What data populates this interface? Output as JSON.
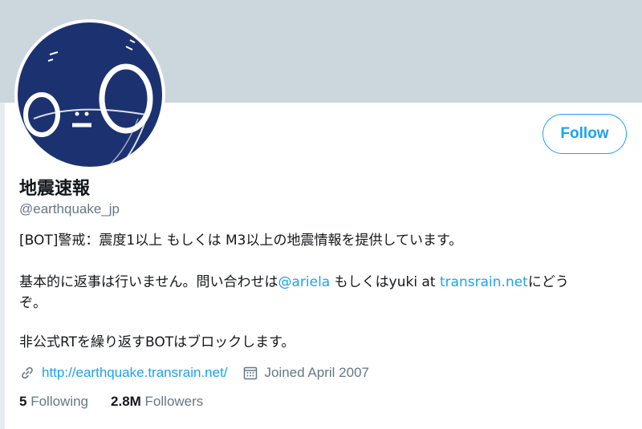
{
  "profile": {
    "display_name": "地震速報",
    "handle": "@earthquake_jp",
    "follow_label": "Follow",
    "avatar_label": "o_O"
  },
  "bio": {
    "line1": "[BOT]警戒：震度1以上 もしくは M3以上の地震情報を提供しています。",
    "line2_prefix": "基本的に返事は行いません。問い合わせは",
    "line2_mention": "@ariela",
    "line2_middle": " もしくはyuki at ",
    "line2_link": "transrain.net",
    "line2_suffix": "にどう",
    "line3": "ぞ。",
    "line4": "非公式RTを繰り返すBOTはブロックします。"
  },
  "meta": {
    "url": "http://earthquake.transrain.net/",
    "joined": "Joined April 2007",
    "link_icon": "link-icon",
    "calendar_icon": "calendar-icon"
  },
  "counts": {
    "following_value": "5",
    "following_label": "Following",
    "followers_value": "2.8M",
    "followers_label": "Followers"
  },
  "colors": {
    "accent": "#1da1f2",
    "banner": "#ccd6dd",
    "avatar_bg": "#1c3270",
    "secondary_text": "#657786"
  }
}
